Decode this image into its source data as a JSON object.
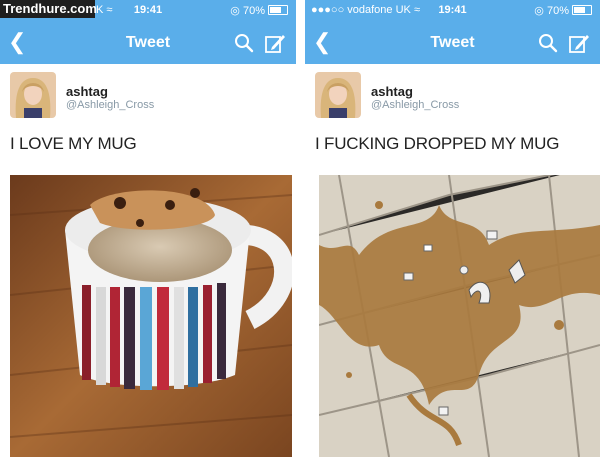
{
  "watermark": "Trendhure.com",
  "colors": {
    "accent": "#5aaeea",
    "text": "#222222",
    "muted": "#8899a6"
  },
  "left": {
    "status": {
      "carrier_tail": "UK",
      "time": "19:41",
      "battery": "70%"
    },
    "nav": {
      "title": "Tweet",
      "back_icon": "chevron-left-icon",
      "search_icon": "search-icon",
      "compose_icon": "compose-icon"
    },
    "author": {
      "name": "ashtag",
      "handle": "@Ashleigh_Cross"
    },
    "tweet_text": "I LOVE MY MUG",
    "photo": "mug-of-tea-on-wooden-table"
  },
  "right": {
    "status": {
      "carrier": "●●●○○ vodafone UK",
      "time": "19:41",
      "battery": "70%"
    },
    "nav": {
      "title": "Tweet",
      "back_icon": "chevron-left-icon",
      "search_icon": "search-icon",
      "compose_icon": "compose-icon"
    },
    "author": {
      "name": "ashtag",
      "handle": "@Ashleigh_Cross"
    },
    "tweet_text": "I FUCKING DROPPED MY MUG",
    "photo": "broken-mug-spilled-on-tile-floor"
  }
}
